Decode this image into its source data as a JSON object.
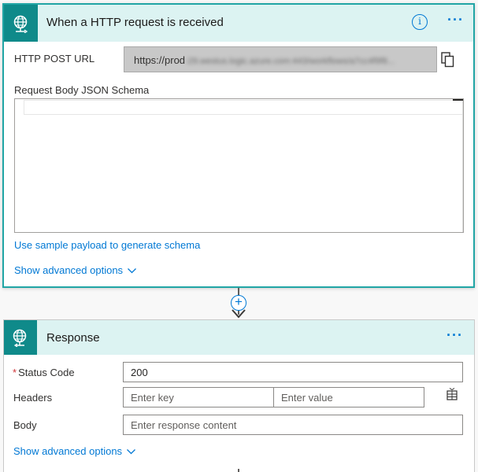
{
  "trigger": {
    "title": "When a HTTP request is received",
    "info_label": "i",
    "more_label": "···",
    "post_url_label": "HTTP POST URL",
    "post_url_prefix": "https://prod",
    "post_url_rest": "-29.westus.logic.azure.com:443/workflows/a7cc4f9f8...",
    "schema_label": "Request Body JSON Schema",
    "schema_value": "",
    "sample_link": "Use sample payload to generate schema",
    "advanced_link": "Show advanced options"
  },
  "connector": {
    "add_label": "+"
  },
  "response": {
    "title": "Response",
    "more_label": "···",
    "status_label": "Status Code",
    "status_required": "*",
    "status_value": "200",
    "headers_label": "Headers",
    "key_placeholder": "Enter key",
    "value_placeholder": "Enter value",
    "body_label": "Body",
    "body_placeholder": "Enter response content",
    "advanced_link": "Show advanced options"
  },
  "icons": {
    "trigger": "globe-request-icon",
    "response": "globe-response-icon",
    "copy": "copy-icon",
    "info": "info-icon",
    "more": "more-dots-icon",
    "chevron": "chevron-down-icon",
    "add": "plus-circle-icon",
    "table": "table-switch-icon"
  },
  "colors": {
    "accent": "#0078d4",
    "teal": "#0f8a8a",
    "header_bg": "#dcf3f2",
    "selected_border": "#21a5a5",
    "required": "#d13438"
  }
}
